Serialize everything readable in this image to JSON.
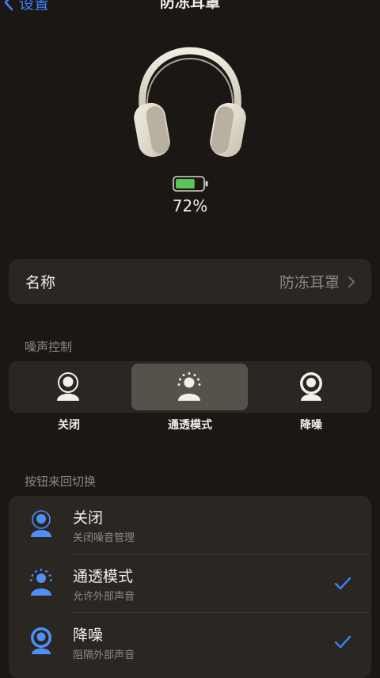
{
  "nav": {
    "back_label": "设置",
    "title": "防冻耳罩"
  },
  "device": {
    "battery_percent": "72%",
    "battery_level": 0.72,
    "battery_color": "#5ec25a"
  },
  "name_row": {
    "label": "名称",
    "value": "防冻耳罩"
  },
  "noise_control": {
    "section_label": "噪声控制",
    "options": [
      {
        "label": "关闭",
        "icon": "person-icon"
      },
      {
        "label": "通透模式",
        "icon": "transparency-icon",
        "selected": true
      },
      {
        "label": "降噪",
        "icon": "noise-cancel-icon"
      }
    ]
  },
  "button_cycle": {
    "section_label": "按钮来回切换",
    "items": [
      {
        "title": "关闭",
        "subtitle": "关闭噪音管理",
        "checked": false
      },
      {
        "title": "通透模式",
        "subtitle": "允许外部声音",
        "checked": true
      },
      {
        "title": "降噪",
        "subtitle": "阻隔外部声音",
        "checked": true
      }
    ]
  },
  "colors": {
    "accent": "#3b82f6",
    "background": "#1b1714",
    "card": "#2a2622",
    "selected_segment": "#55514b"
  }
}
